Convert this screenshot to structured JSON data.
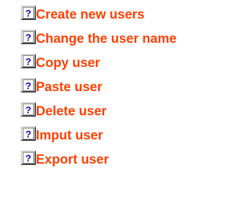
{
  "icon": {
    "name": "help-topic-icon",
    "glyph": "?"
  },
  "items": [
    {
      "label": "Create new users"
    },
    {
      "label": "Change the user name"
    },
    {
      "label": "Copy user"
    },
    {
      "label": "Paste user"
    },
    {
      "label": "Delete user"
    },
    {
      "label": "Imput user"
    },
    {
      "label": "Export user"
    }
  ],
  "colors": {
    "link_text": "#ff4000",
    "icon_glyph": "#0000cc",
    "background": "#ffffff"
  }
}
